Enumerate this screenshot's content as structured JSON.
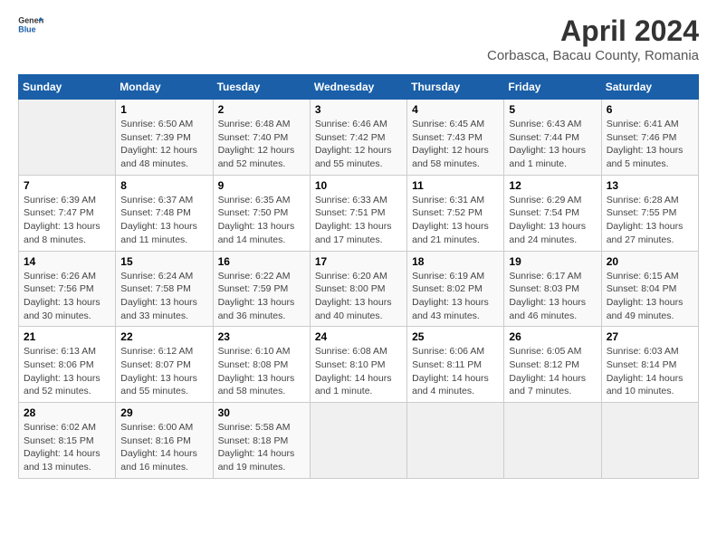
{
  "header": {
    "logo": {
      "text_general": "General",
      "text_blue": "Blue"
    },
    "title": "April 2024",
    "location": "Corbasca, Bacau County, Romania"
  },
  "calendar": {
    "days_of_week": [
      "Sunday",
      "Monday",
      "Tuesday",
      "Wednesday",
      "Thursday",
      "Friday",
      "Saturday"
    ],
    "weeks": [
      [
        {
          "day": "",
          "info": ""
        },
        {
          "day": "1",
          "info": "Sunrise: 6:50 AM\nSunset: 7:39 PM\nDaylight: 12 hours\nand 48 minutes."
        },
        {
          "day": "2",
          "info": "Sunrise: 6:48 AM\nSunset: 7:40 PM\nDaylight: 12 hours\nand 52 minutes."
        },
        {
          "day": "3",
          "info": "Sunrise: 6:46 AM\nSunset: 7:42 PM\nDaylight: 12 hours\nand 55 minutes."
        },
        {
          "day": "4",
          "info": "Sunrise: 6:45 AM\nSunset: 7:43 PM\nDaylight: 12 hours\nand 58 minutes."
        },
        {
          "day": "5",
          "info": "Sunrise: 6:43 AM\nSunset: 7:44 PM\nDaylight: 13 hours\nand 1 minute."
        },
        {
          "day": "6",
          "info": "Sunrise: 6:41 AM\nSunset: 7:46 PM\nDaylight: 13 hours\nand 5 minutes."
        }
      ],
      [
        {
          "day": "7",
          "info": "Sunrise: 6:39 AM\nSunset: 7:47 PM\nDaylight: 13 hours\nand 8 minutes."
        },
        {
          "day": "8",
          "info": "Sunrise: 6:37 AM\nSunset: 7:48 PM\nDaylight: 13 hours\nand 11 minutes."
        },
        {
          "day": "9",
          "info": "Sunrise: 6:35 AM\nSunset: 7:50 PM\nDaylight: 13 hours\nand 14 minutes."
        },
        {
          "day": "10",
          "info": "Sunrise: 6:33 AM\nSunset: 7:51 PM\nDaylight: 13 hours\nand 17 minutes."
        },
        {
          "day": "11",
          "info": "Sunrise: 6:31 AM\nSunset: 7:52 PM\nDaylight: 13 hours\nand 21 minutes."
        },
        {
          "day": "12",
          "info": "Sunrise: 6:29 AM\nSunset: 7:54 PM\nDaylight: 13 hours\nand 24 minutes."
        },
        {
          "day": "13",
          "info": "Sunrise: 6:28 AM\nSunset: 7:55 PM\nDaylight: 13 hours\nand 27 minutes."
        }
      ],
      [
        {
          "day": "14",
          "info": "Sunrise: 6:26 AM\nSunset: 7:56 PM\nDaylight: 13 hours\nand 30 minutes."
        },
        {
          "day": "15",
          "info": "Sunrise: 6:24 AM\nSunset: 7:58 PM\nDaylight: 13 hours\nand 33 minutes."
        },
        {
          "day": "16",
          "info": "Sunrise: 6:22 AM\nSunset: 7:59 PM\nDaylight: 13 hours\nand 36 minutes."
        },
        {
          "day": "17",
          "info": "Sunrise: 6:20 AM\nSunset: 8:00 PM\nDaylight: 13 hours\nand 40 minutes."
        },
        {
          "day": "18",
          "info": "Sunrise: 6:19 AM\nSunset: 8:02 PM\nDaylight: 13 hours\nand 43 minutes."
        },
        {
          "day": "19",
          "info": "Sunrise: 6:17 AM\nSunset: 8:03 PM\nDaylight: 13 hours\nand 46 minutes."
        },
        {
          "day": "20",
          "info": "Sunrise: 6:15 AM\nSunset: 8:04 PM\nDaylight: 13 hours\nand 49 minutes."
        }
      ],
      [
        {
          "day": "21",
          "info": "Sunrise: 6:13 AM\nSunset: 8:06 PM\nDaylight: 13 hours\nand 52 minutes."
        },
        {
          "day": "22",
          "info": "Sunrise: 6:12 AM\nSunset: 8:07 PM\nDaylight: 13 hours\nand 55 minutes."
        },
        {
          "day": "23",
          "info": "Sunrise: 6:10 AM\nSunset: 8:08 PM\nDaylight: 13 hours\nand 58 minutes."
        },
        {
          "day": "24",
          "info": "Sunrise: 6:08 AM\nSunset: 8:10 PM\nDaylight: 14 hours\nand 1 minute."
        },
        {
          "day": "25",
          "info": "Sunrise: 6:06 AM\nSunset: 8:11 PM\nDaylight: 14 hours\nand 4 minutes."
        },
        {
          "day": "26",
          "info": "Sunrise: 6:05 AM\nSunset: 8:12 PM\nDaylight: 14 hours\nand 7 minutes."
        },
        {
          "day": "27",
          "info": "Sunrise: 6:03 AM\nSunset: 8:14 PM\nDaylight: 14 hours\nand 10 minutes."
        }
      ],
      [
        {
          "day": "28",
          "info": "Sunrise: 6:02 AM\nSunset: 8:15 PM\nDaylight: 14 hours\nand 13 minutes."
        },
        {
          "day": "29",
          "info": "Sunrise: 6:00 AM\nSunset: 8:16 PM\nDaylight: 14 hours\nand 16 minutes."
        },
        {
          "day": "30",
          "info": "Sunrise: 5:58 AM\nSunset: 8:18 PM\nDaylight: 14 hours\nand 19 minutes."
        },
        {
          "day": "",
          "info": ""
        },
        {
          "day": "",
          "info": ""
        },
        {
          "day": "",
          "info": ""
        },
        {
          "day": "",
          "info": ""
        }
      ]
    ]
  }
}
